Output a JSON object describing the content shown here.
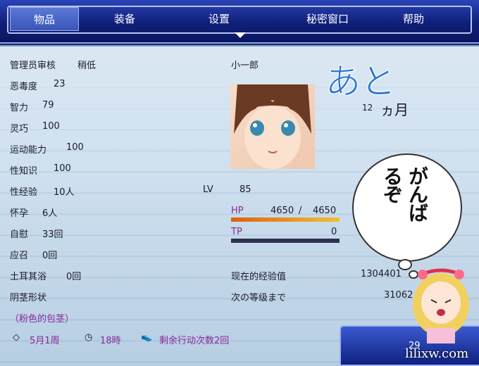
{
  "menu": {
    "tabs": [
      "物品",
      "装备",
      "设置",
      "秘密窗口",
      "帮助"
    ]
  },
  "stats": [
    {
      "label": "管理员审核",
      "value": "稍低"
    },
    {
      "label": "恶毒度",
      "value": "23"
    },
    {
      "label": "智力",
      "value": "79"
    },
    {
      "label": "灵巧",
      "value": "100"
    },
    {
      "label": "运动能力",
      "value": "100"
    },
    {
      "label": "性知识",
      "value": "100"
    },
    {
      "label": "性经验",
      "value": "10人"
    },
    {
      "label": "怀孕",
      "value": "6人"
    },
    {
      "label": "自慰",
      "value": "33回"
    },
    {
      "label": "应召",
      "value": "0回"
    },
    {
      "label": "土耳其浴",
      "value": "0回"
    },
    {
      "label": "阴茎形状",
      "value": ""
    }
  ],
  "extra_tag": "（粉色的包茎）",
  "character": {
    "name": "小一郎",
    "lv_label": "LV",
    "lv": "85",
    "hp_label": "HP",
    "hp": "4650",
    "hp_max": "4650",
    "hp_sep": "/",
    "tp_label": "TP",
    "tp": "0",
    "hp_fraction": 1.0,
    "tp_fraction": 0.0
  },
  "countdown": {
    "word": "あと",
    "months": "12",
    "unit": "ヵ月"
  },
  "exp": {
    "current_label": "现在的经验值",
    "current": "1304401",
    "next_label": "次の等级まで",
    "next": "31062"
  },
  "bubble_text": [
    "がんば",
    "るぞ"
  ],
  "bottom": {
    "date": "5月1周",
    "time": "18時",
    "actions": "剩余行动次数2回",
    "money": "29"
  },
  "watermark": "lilixw.com",
  "colors": {
    "menu": "#0f1f78",
    "panel": "#c9dcec",
    "hp_bar": "#f0a020",
    "tp_bar": "#303050"
  }
}
